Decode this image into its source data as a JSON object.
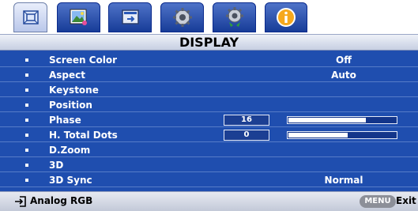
{
  "tabs": [
    {
      "icon": "picture-icon"
    },
    {
      "icon": "display-image-icon"
    },
    {
      "icon": "source-input-icon"
    },
    {
      "icon": "gear-settings-icon"
    },
    {
      "icon": "gear-advanced-icon"
    },
    {
      "icon": "info-icon"
    }
  ],
  "active_tab_index": 0,
  "menu": {
    "title": "DISPLAY",
    "rows": [
      {
        "label": "Screen Color",
        "value": "Off"
      },
      {
        "label": "Aspect",
        "value": "Auto"
      },
      {
        "label": "Keystone",
        "value": ""
      },
      {
        "label": "Position",
        "value": ""
      },
      {
        "label": "Phase",
        "number": "16",
        "slider_level": 0.72
      },
      {
        "label": "H. Total Dots",
        "number": "0",
        "slider_level": 0.55
      },
      {
        "label": "D.Zoom",
        "value": ""
      },
      {
        "label": "3D",
        "value": ""
      },
      {
        "label": "3D Sync",
        "value": "Normal"
      }
    ]
  },
  "footer": {
    "source_icon": "input-arrow-icon",
    "source_label": "Analog RGB",
    "menu_key": "MENU",
    "exit_label": "Exit"
  },
  "colors": {
    "panel": "#1f4eaf",
    "tab_blue": "#173c98",
    "accent_white": "#ffffff"
  }
}
